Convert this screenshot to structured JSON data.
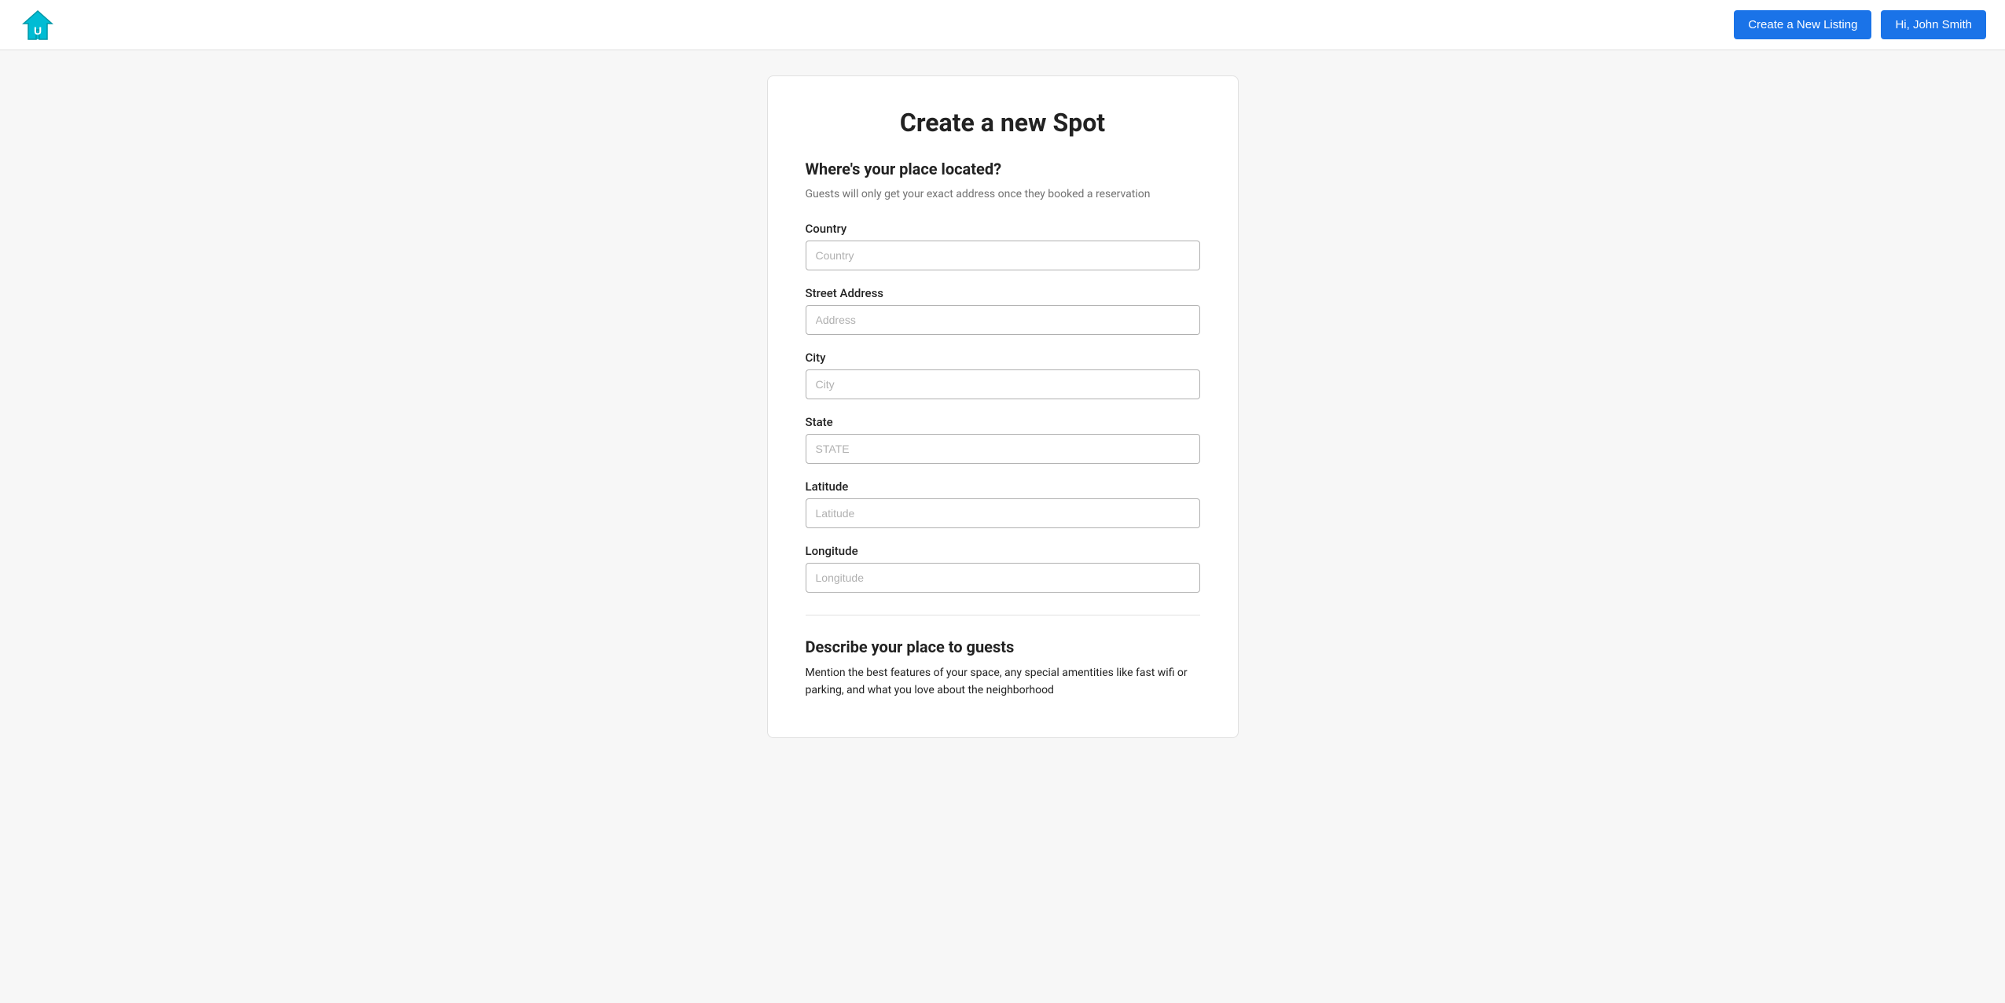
{
  "navbar": {
    "create_listing_label": "Create a New Listing",
    "user_greeting": "Hi, John Smith",
    "logo_alt": "Home Away Logo"
  },
  "form": {
    "title": "Create a new Spot",
    "location_section": {
      "heading": "Where's your place located?",
      "description": "Guests will only get your exact address once they booked a reservation"
    },
    "fields": {
      "country": {
        "label": "Country",
        "placeholder": "Country"
      },
      "street_address": {
        "label": "Street Address",
        "placeholder": "Address"
      },
      "city": {
        "label": "City",
        "placeholder": "City"
      },
      "state": {
        "label": "State",
        "placeholder": "STATE"
      },
      "latitude": {
        "label": "Latitude",
        "placeholder": "Latitude"
      },
      "longitude": {
        "label": "Longitude",
        "placeholder": "Longitude"
      }
    },
    "description_section": {
      "heading": "Describe your place to guests",
      "description_prefix": "Mention ",
      "description_highlight": "the best features of your space, any special amentities like fast wifi or parking, and what you love about the neighborhood"
    }
  }
}
